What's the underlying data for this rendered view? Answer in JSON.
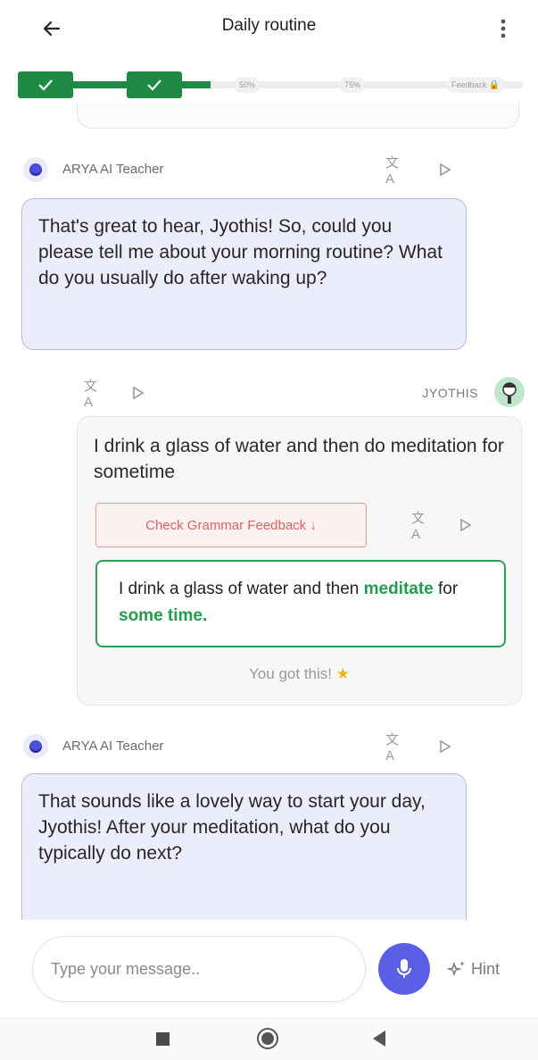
{
  "header": {
    "title": "Daily routine",
    "back_icon": "arrow-left-icon",
    "menu_icon": "more-vertical-icon"
  },
  "progress": {
    "completed_steps": 2,
    "milestones": [
      "50%",
      "75%",
      "Feedback"
    ],
    "accent": "#1e8a43"
  },
  "messages": [
    {
      "role": "teacher",
      "sender": "ARYA AI Teacher",
      "text": "That's great to hear, Jyothis! So, could you please tell me about your morning routine? What do you usually do after waking up?"
    },
    {
      "role": "user",
      "sender": "JYOTHIS",
      "text": "I drink a glass of water and then do meditation for sometime",
      "grammar_button": "Check Grammar Feedback ↓",
      "correction": {
        "prefix": "I drink a glass of water and then ",
        "word1": "meditate",
        "mid": " for ",
        "word2": "some time."
      },
      "encouragement": "You got this!",
      "encouragement_emoji": "★"
    },
    {
      "role": "teacher",
      "sender": "ARYA AI Teacher",
      "text": "That sounds like a lovely way to start your day, Jyothis! After your meditation, what do you typically do next?"
    }
  ],
  "composer": {
    "placeholder": "Type your message..",
    "hint_label": "Hint",
    "mic_color": "#5a5fe6"
  },
  "icons": {
    "translate": "文A",
    "checkmark": "✓"
  }
}
